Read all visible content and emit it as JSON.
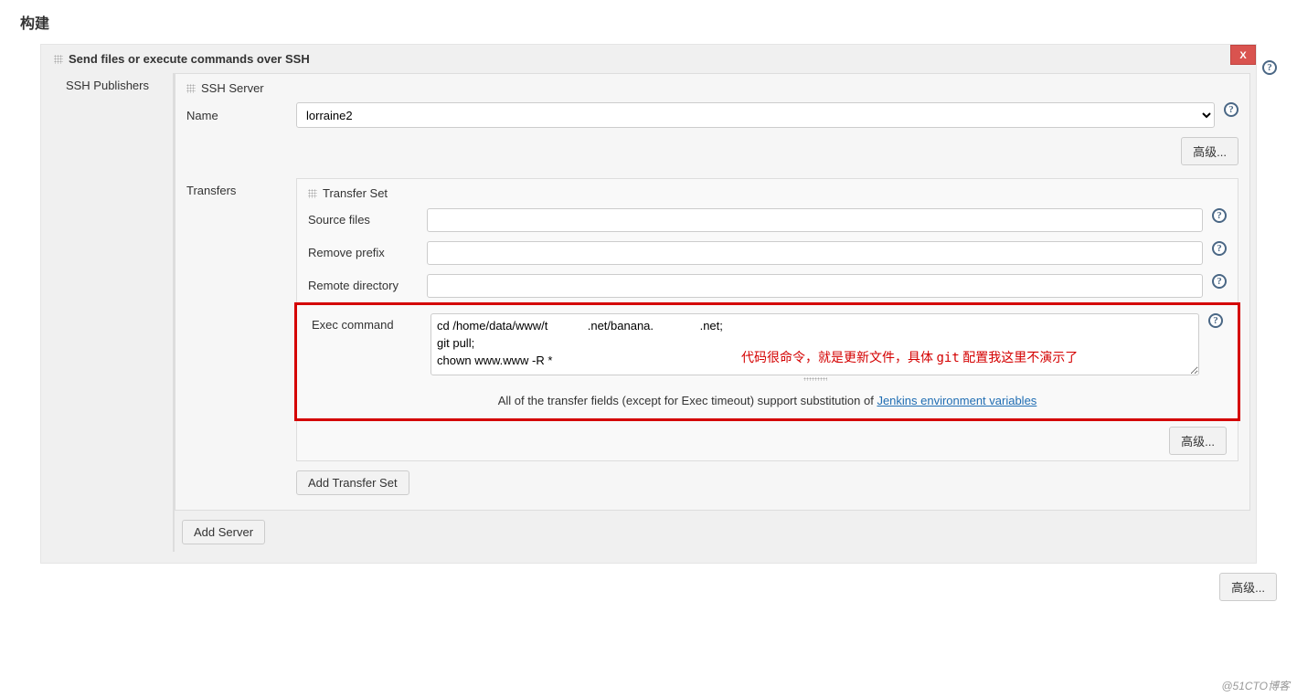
{
  "section_title": "构建",
  "step": {
    "title": "Send files or execute commands over SSH",
    "close_label": "X"
  },
  "labels": {
    "ssh_publishers": "SSH Publishers",
    "ssh_server": "SSH Server",
    "name": "Name",
    "advanced": "高级...",
    "transfers": "Transfers",
    "transfer_set": "Transfer Set",
    "source_files": "Source files",
    "remove_prefix": "Remove prefix",
    "remote_directory": "Remote directory",
    "exec_command": "Exec command",
    "add_transfer_set": "Add Transfer Set",
    "add_server": "Add Server"
  },
  "server": {
    "selected": "lorraine2"
  },
  "transfer": {
    "source_files": "",
    "remove_prefix": "",
    "remote_directory": "",
    "exec_command_value": "cd /home/data/www/t            .net/banana.              .net;\ngit pull;\nchown www.www -R *",
    "note_prefix": "All of the transfer fields (except for Exec timeout) support substitution of ",
    "note_link": "Jenkins environment variables"
  },
  "annotation": {
    "text_a": "代码很命令，就是更新文件，具体 ",
    "text_mono": "git",
    "text_b": " 配置我这里不演示了"
  },
  "watermark": "@51CTO博客"
}
